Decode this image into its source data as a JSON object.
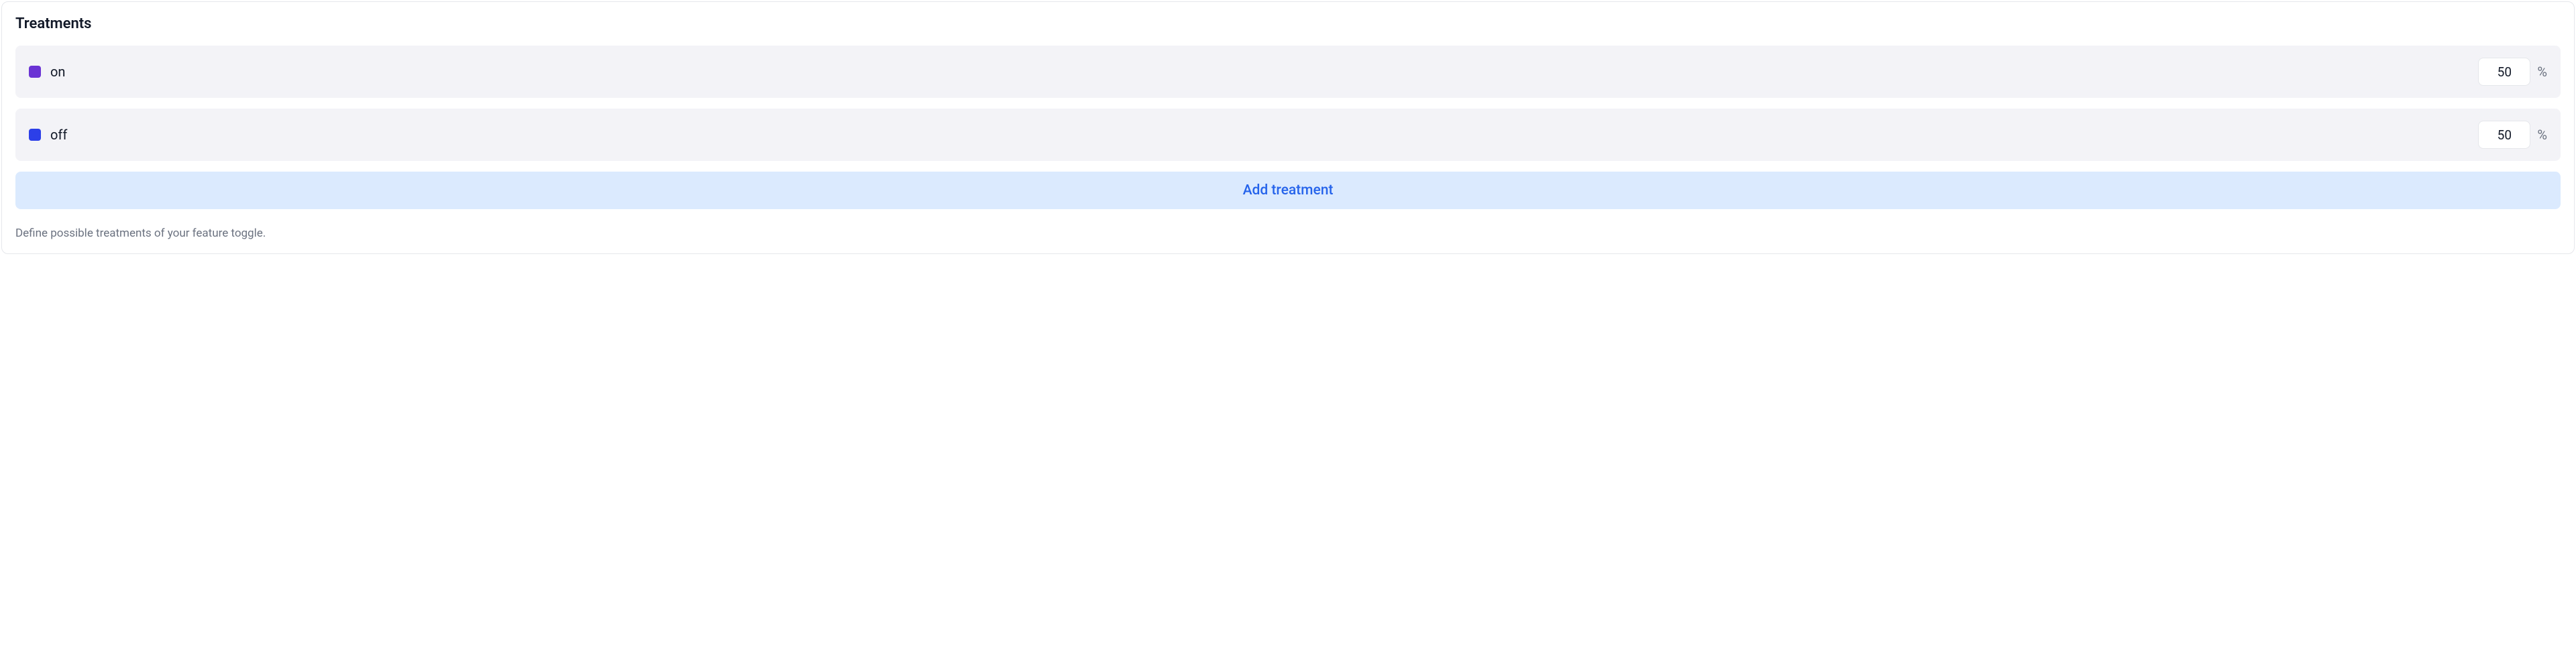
{
  "panel": {
    "title": "Treatments",
    "help_text": "Define possible treatments of your feature toggle.",
    "add_button_label": "Add treatment",
    "percent_sign": "%"
  },
  "treatments": [
    {
      "label": "on",
      "value": "50",
      "color": "#6a33d4"
    },
    {
      "label": "off",
      "value": "50",
      "color": "#2c3fe8"
    }
  ]
}
